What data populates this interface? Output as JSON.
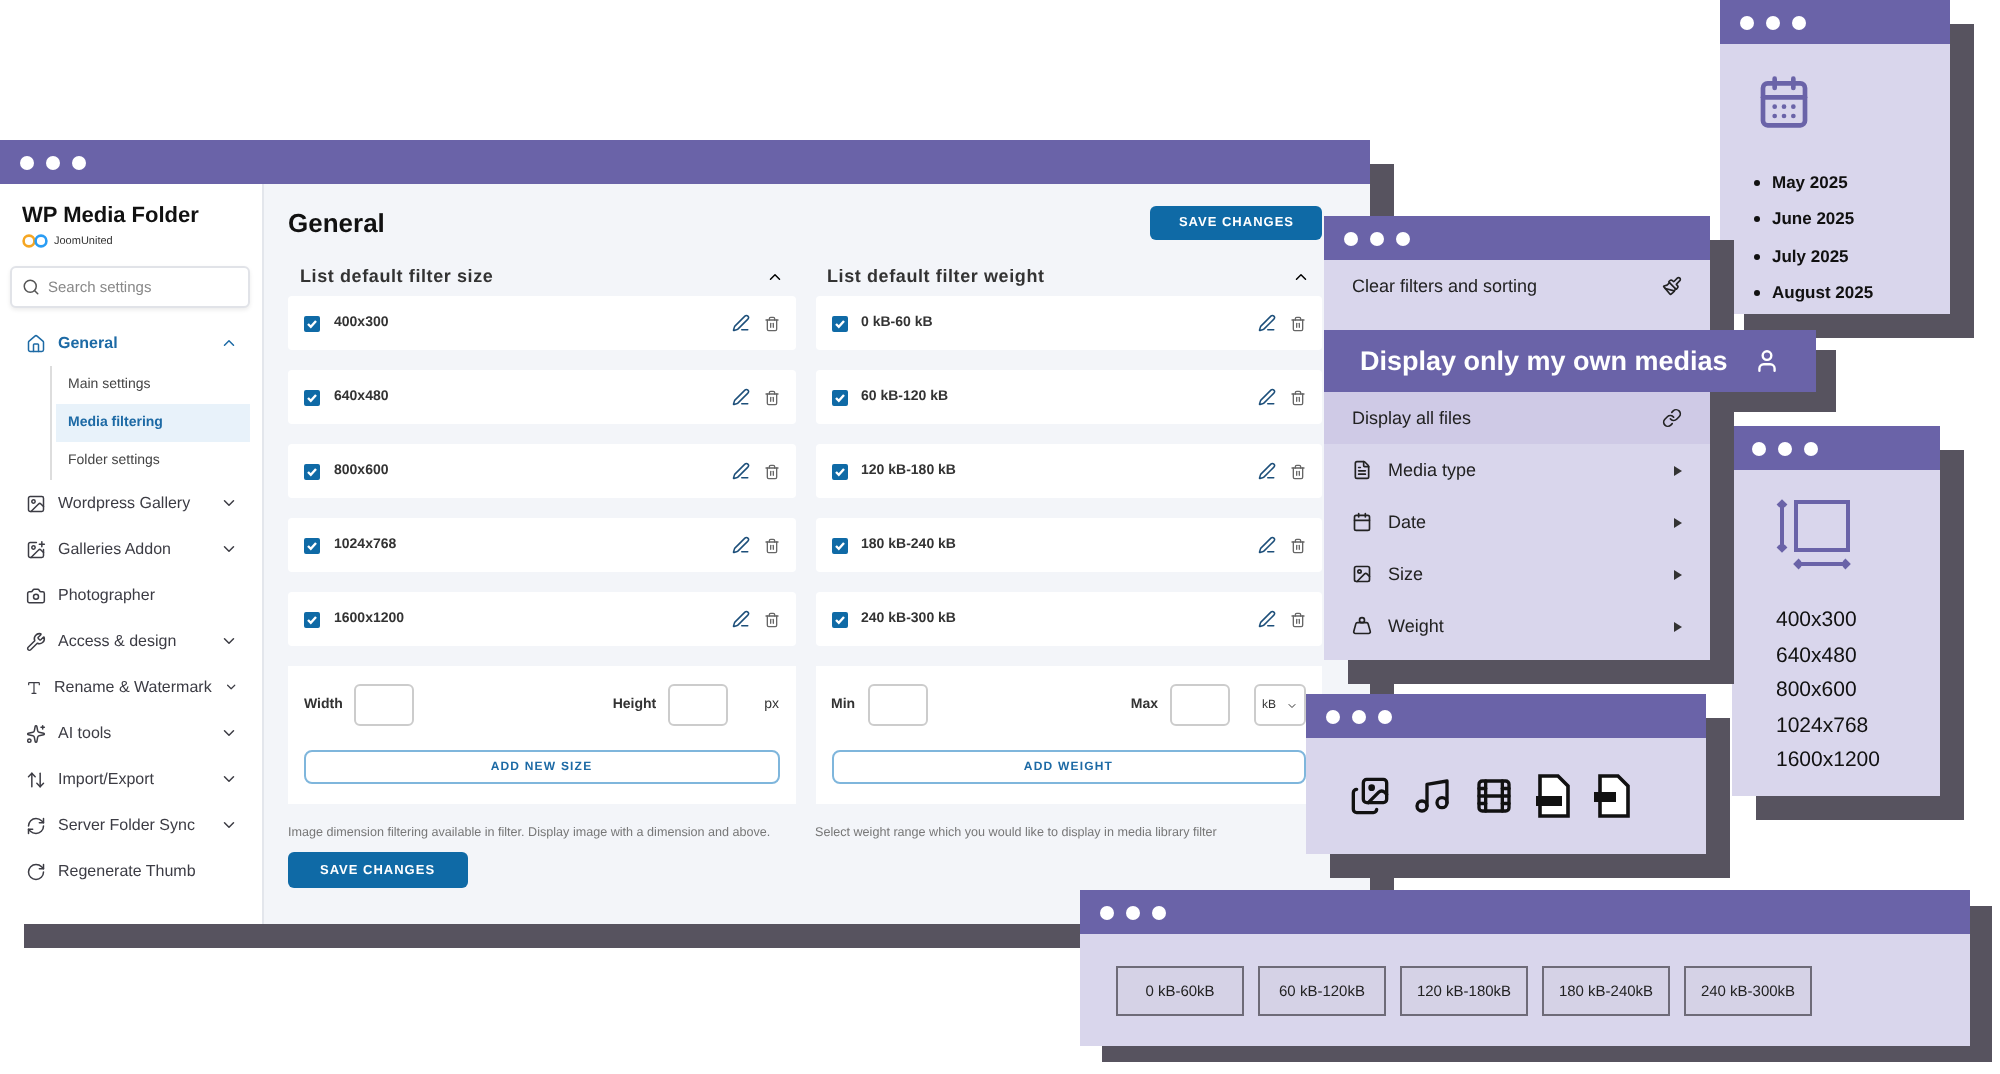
{
  "main_window": {
    "app_name": "WP Media Folder",
    "brand": "JoomUnited",
    "search": {
      "placeholder": "Search settings"
    },
    "nav": [
      {
        "label": "General",
        "kind": "group",
        "expanded": true,
        "selected": true,
        "children": [
          {
            "label": "Main settings",
            "selected": false
          },
          {
            "label": "Media filtering",
            "selected": true
          },
          {
            "label": "Folder settings",
            "selected": false
          }
        ]
      },
      {
        "label": "Wordpress Gallery",
        "kind": "group",
        "expanded": false,
        "selected": false
      },
      {
        "label": "Galleries Addon",
        "kind": "group",
        "expanded": false,
        "selected": false
      },
      {
        "label": "Photographer",
        "kind": "link",
        "selected": false
      },
      {
        "label": "Access & design",
        "kind": "group",
        "expanded": false,
        "selected": false
      },
      {
        "label": "Rename & Watermark",
        "kind": "group",
        "expanded": false,
        "selected": false
      },
      {
        "label": "AI tools",
        "kind": "group",
        "expanded": false,
        "selected": false
      },
      {
        "label": "Import/Export",
        "kind": "group",
        "expanded": false,
        "selected": false
      },
      {
        "label": "Server Folder Sync",
        "kind": "group",
        "expanded": false,
        "selected": false
      },
      {
        "label": "Regenerate Thumb",
        "kind": "link",
        "selected": false
      }
    ],
    "page_title": "General",
    "top_button": "SAVE CHANGES",
    "panels": [
      {
        "title": "List default filter size",
        "expanded": true,
        "items": [
          {
            "label": "400x300",
            "checked": true
          },
          {
            "label": "640x480",
            "checked": true
          },
          {
            "label": "800x600",
            "checked": true
          },
          {
            "label": "1024x768",
            "checked": true
          },
          {
            "label": "1600x1200",
            "checked": true
          }
        ],
        "fields": [
          {
            "label": "Width"
          },
          {
            "label": "Height"
          }
        ],
        "unit": {
          "kind": "text",
          "text": "px"
        },
        "add_button": "ADD NEW SIZE",
        "note": "Image dimension filtering available in filter. Display image with a dimension and above.",
        "bottom_button": "SAVE CHANGES"
      },
      {
        "title": "List default filter weight",
        "expanded": true,
        "items": [
          {
            "label": "0 kB-60 kB",
            "checked": true
          },
          {
            "label": "60 kB-120 kB",
            "checked": true
          },
          {
            "label": "120 kB-180 kB",
            "checked": true
          },
          {
            "label": "180 kB-240 kB",
            "checked": true
          },
          {
            "label": "240 kB-300 kB",
            "checked": true
          }
        ],
        "fields": [
          {
            "label": "Min"
          },
          {
            "label": "Max"
          }
        ],
        "unit": {
          "kind": "select",
          "text": "kB"
        },
        "add_button": "ADD WEIGHT",
        "note": "Select weight range which you would like to display in media library filter"
      }
    ]
  },
  "filter_menu": {
    "items": [
      {
        "label": "Clear filters and sorting",
        "kind": "action",
        "selected": false
      },
      {
        "label": "Display all files",
        "kind": "action",
        "selected": true
      },
      {
        "label": "Media type",
        "kind": "submenu",
        "selected": false
      },
      {
        "label": "Date",
        "kind": "submenu",
        "selected": false
      },
      {
        "label": "Size",
        "kind": "submenu",
        "selected": false
      },
      {
        "label": "Weight",
        "kind": "submenu",
        "selected": false
      }
    ]
  },
  "own_media_banner": {
    "label": "Display only my own medias"
  },
  "date_window": {
    "months": [
      "May 2025",
      "June 2025",
      "July 2025",
      "August 2025"
    ]
  },
  "size_window": {
    "sizes": [
      "400x300",
      "640x480",
      "800x600",
      "1024x768",
      "1600x1200"
    ]
  },
  "weight_window": {
    "ranges": [
      "0 kB-60kB",
      "60 kB-120kB",
      "120 kB-180kB",
      "180 kB-240kB",
      "240 kB-300kB"
    ]
  }
}
